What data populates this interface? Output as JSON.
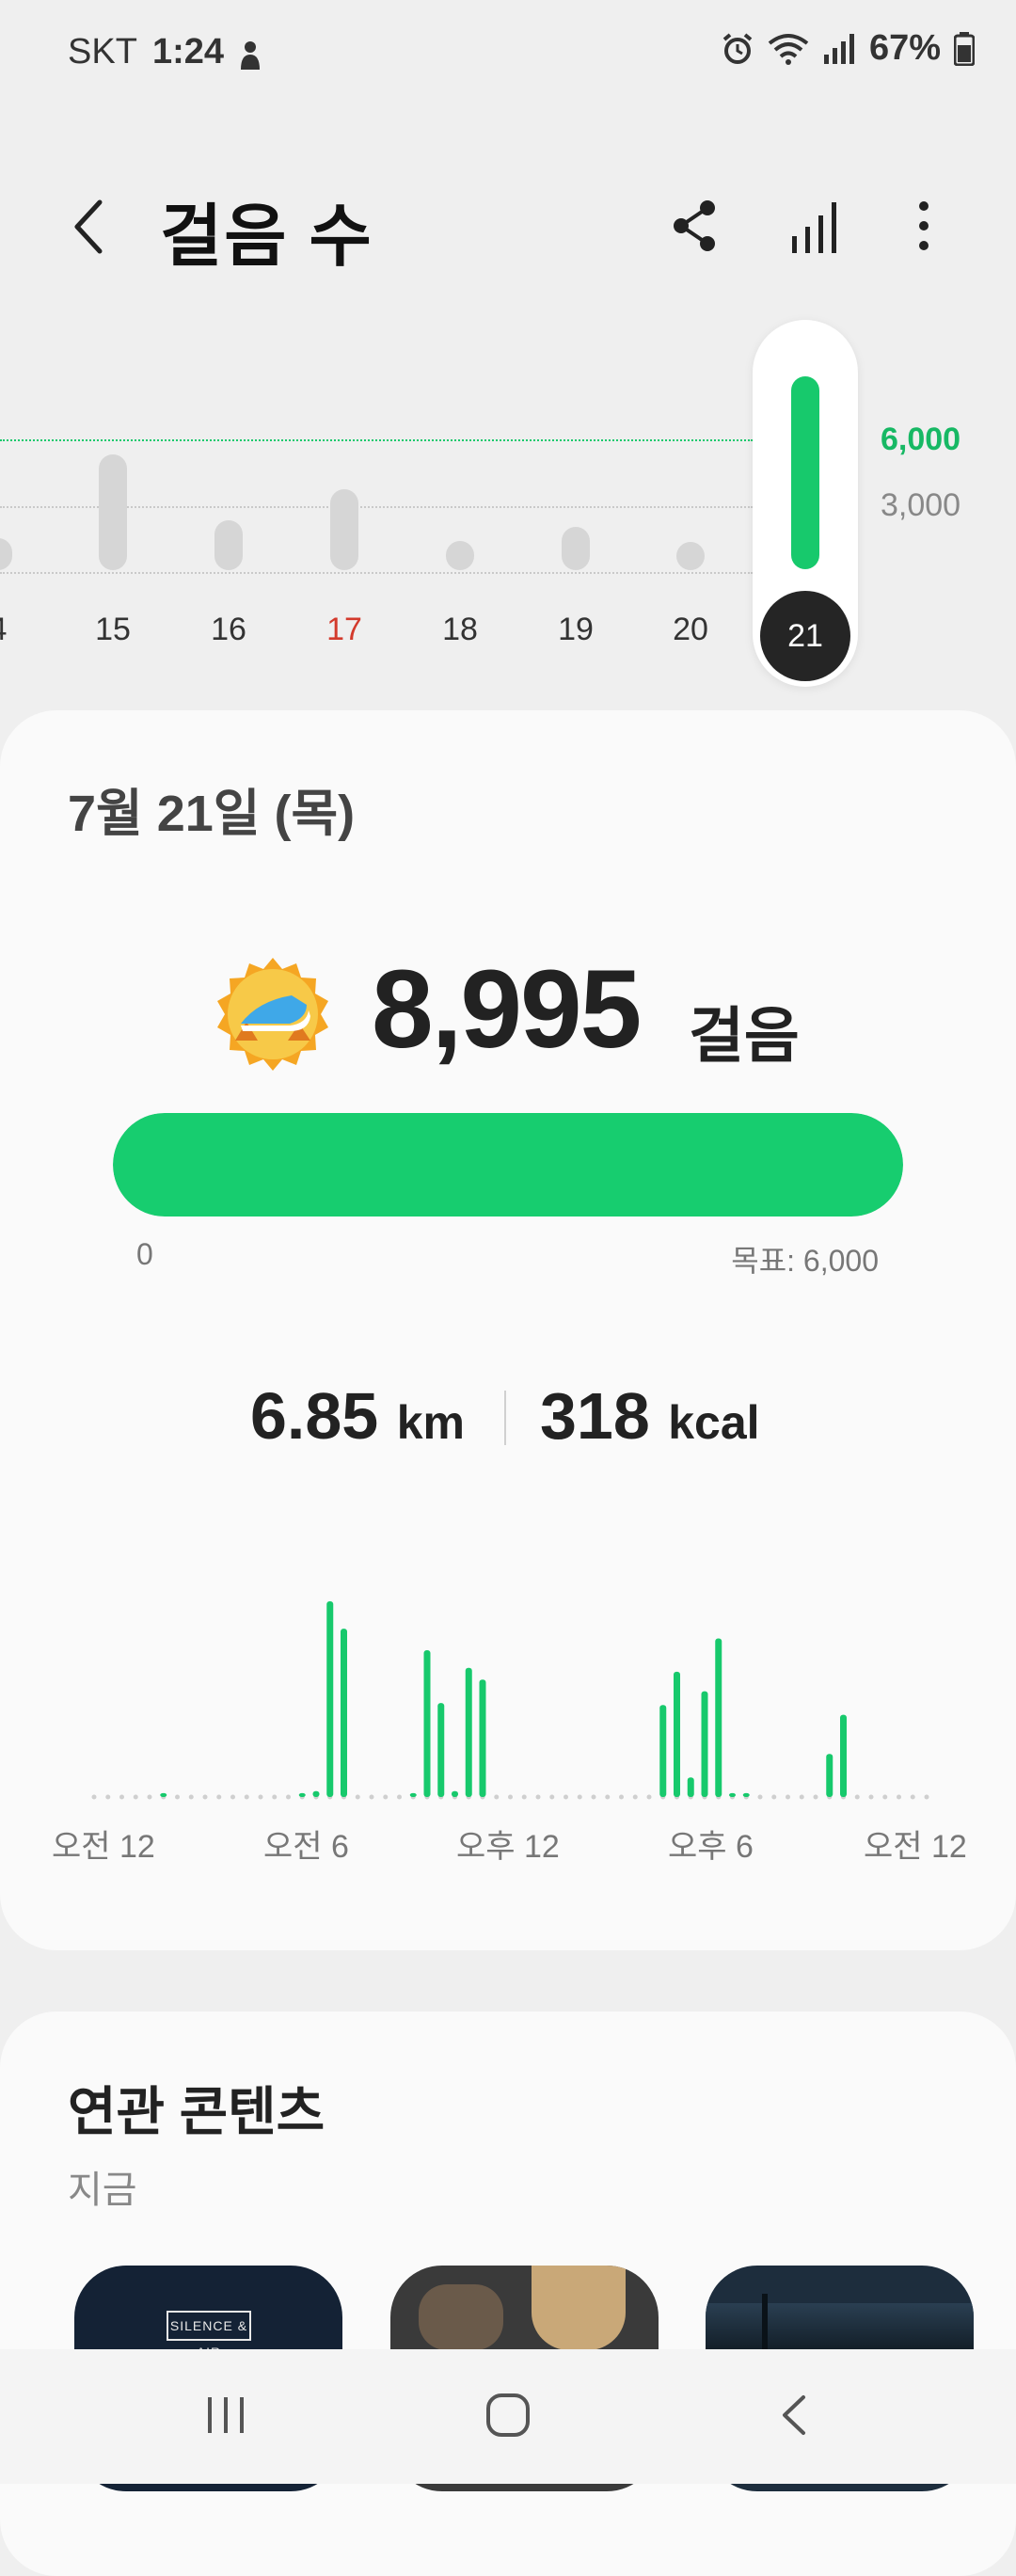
{
  "status_bar": {
    "carrier": "SKT",
    "time": "1:24",
    "battery": "67%",
    "icons": [
      "person-icon",
      "alarm-icon",
      "wifi-icon",
      "signal-icon",
      "battery-icon"
    ]
  },
  "header": {
    "title": "걸음 수",
    "icons": [
      "back-icon",
      "share-icon",
      "chart-icon",
      "more-icon"
    ]
  },
  "week_chart": {
    "days": [
      "4",
      "15",
      "16",
      "17",
      "18",
      "19",
      "20",
      "21"
    ],
    "highlight_day": "17",
    "selected_day": "21",
    "y_labels": [
      "6,000",
      "3,000"
    ],
    "goal_line": 6000,
    "colors": {
      "accent": "#17c96c",
      "highlight": "#d33a2c",
      "bar": "#d6d6d6"
    }
  },
  "summary": {
    "date": "7월 21일 (목)",
    "steps": "8,995",
    "steps_unit": "걸음",
    "progress_min": "0",
    "progress_goal_label": "목표: 6,000",
    "progress_fraction": 1.0,
    "distance_value": "6.85",
    "distance_unit": "km",
    "calories_value": "318",
    "calories_unit": "kcal"
  },
  "chart_data": {
    "type": "bar",
    "x_labels": [
      "오전 12",
      "오전 6",
      "오후 12",
      "오후 6",
      "오전 12"
    ],
    "description_unit": "steps per time slot (relative heights)",
    "values": [
      0,
      0,
      0,
      0,
      0,
      0.02,
      0,
      0,
      0,
      0,
      0,
      0,
      0,
      0,
      0,
      0.02,
      0.03,
      1.0,
      0.86,
      0,
      0,
      0,
      0,
      0.02,
      0.75,
      0.48,
      0.03,
      0.66,
      0.6,
      0,
      0,
      0,
      0,
      0,
      0,
      0,
      0,
      0,
      0,
      0,
      0,
      0.47,
      0.64,
      0.1,
      0.54,
      0.81,
      0.02,
      0.02,
      0,
      0,
      0,
      0,
      0,
      0.22,
      0.42,
      0,
      0,
      0,
      0,
      0,
      0
    ]
  },
  "related": {
    "title": "연관 콘텐츠",
    "subtitle": "지금",
    "thumb1_text": "SILENCE & AIR"
  },
  "nav": {
    "icons": [
      "recents-icon",
      "home-icon",
      "back-nav-icon"
    ]
  }
}
